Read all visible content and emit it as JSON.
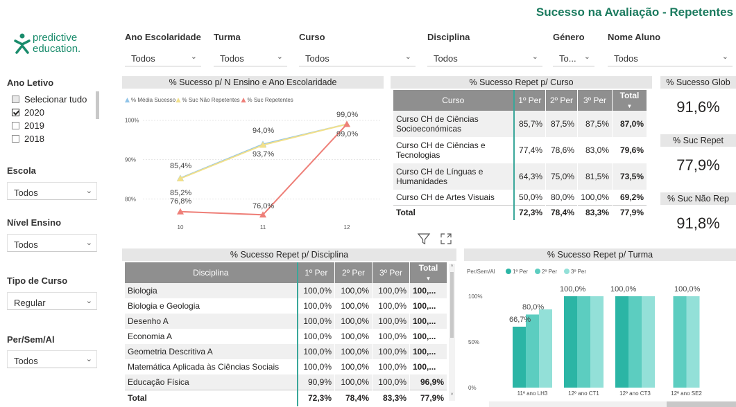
{
  "header": {
    "title": "Sucesso na Avaliação - Repetentes"
  },
  "logo": {
    "line1": "predictive",
    "line2": "education."
  },
  "filters": [
    {
      "label": "Ano Escolaridade",
      "value": "Todos"
    },
    {
      "label": "Turma",
      "value": "Todos"
    },
    {
      "label": "Curso",
      "value": "Todos"
    },
    {
      "label": "Disciplina",
      "value": "Todos"
    },
    {
      "label": "Género",
      "value": "To..."
    },
    {
      "label": "Nome Aluno",
      "value": "Todos"
    }
  ],
  "sidebar": {
    "ano_letivo": {
      "label": "Ano Letivo",
      "items": [
        {
          "label": "Selecionar tudo",
          "checked": false
        },
        {
          "label": "2020",
          "checked": true
        },
        {
          "label": "2019",
          "checked": false
        },
        {
          "label": "2018",
          "checked": false
        }
      ]
    },
    "escola": {
      "label": "Escola",
      "value": "Todos"
    },
    "nivel_ensino": {
      "label": "Nível Ensino",
      "value": "Todos"
    },
    "tipo_curso": {
      "label": "Tipo de Curso",
      "value": "Regular"
    },
    "per_sem": {
      "label": "Per/Sem/Al",
      "value": "Todos"
    }
  },
  "line_chart": {
    "title": "% Sucesso p/ N Ensino e Ano Escolaridade",
    "legend": [
      {
        "label": "% Média Sucesso",
        "color": "#8fc3e8"
      },
      {
        "label": "% Suc Não Repetentes",
        "color": "#f2e08a"
      },
      {
        "label": "% Suc Repetentes",
        "color": "#ee7f78"
      }
    ],
    "y_ticks": [
      "100%",
      "90%",
      "80%"
    ],
    "x_ticks": [
      "10",
      "11",
      "12"
    ]
  },
  "curso_table": {
    "title": "% Sucesso Repet p/ Curso",
    "headers": [
      "Curso",
      "1º Per",
      "2º Per",
      "3º Per",
      "Total"
    ],
    "rows": [
      [
        "Curso CH de Ciências Socioeconómicas",
        "85,7%",
        "87,5%",
        "87,5%",
        "87,0%"
      ],
      [
        "Curso CH de Ciências e Tecnologias",
        "77,4%",
        "78,6%",
        "83,0%",
        "79,6%"
      ],
      [
        "Curso CH de Línguas e Humanidades",
        "64,3%",
        "75,0%",
        "81,5%",
        "73,5%"
      ],
      [
        "Curso CH de Artes Visuais",
        "50,0%",
        "80,0%",
        "100,0%",
        "69,2%"
      ]
    ],
    "total": [
      "Total",
      "72,3%",
      "78,4%",
      "83,3%",
      "77,9%"
    ]
  },
  "cards": [
    {
      "title": "% Sucesso Glob",
      "value": "91,6%"
    },
    {
      "title": "% Suc Repet",
      "value": "77,9%"
    },
    {
      "title": "% Suc Não Rep",
      "value": "91,8%"
    }
  ],
  "disciplina_table": {
    "title": "% Sucesso Repet p/ Disciplina",
    "headers": [
      "Disciplina",
      "1º Per",
      "2º Per",
      "3º Per",
      "Total"
    ],
    "rows": [
      [
        "Biologia",
        "100,0%",
        "100,0%",
        "100,0%",
        "100,..."
      ],
      [
        "Biologia e Geologia",
        "100,0%",
        "100,0%",
        "100,0%",
        "100,..."
      ],
      [
        "Desenho A",
        "100,0%",
        "100,0%",
        "100,0%",
        "100,..."
      ],
      [
        "Economia A",
        "100,0%",
        "100,0%",
        "100,0%",
        "100,..."
      ],
      [
        "Geometria Descritiva A",
        "100,0%",
        "100,0%",
        "100,0%",
        "100,..."
      ],
      [
        "Matemática Aplicada às Ciências Sociais",
        "100,0%",
        "100,0%",
        "100,0%",
        "100,..."
      ],
      [
        "Educação Física",
        "90,9%",
        "100,0%",
        "100,0%",
        "96,9%"
      ]
    ],
    "total": [
      "Total",
      "72,3%",
      "78,4%",
      "83,3%",
      "77,9%"
    ]
  },
  "bar_chart": {
    "title": "% Sucesso Repet p/ Turma",
    "legend_title": "Per/Sem/Al",
    "legend": [
      {
        "label": "1º Per",
        "color": "#2bb5a5"
      },
      {
        "label": "2º Per",
        "color": "#5ccdc0"
      },
      {
        "label": "3º Per",
        "color": "#93e0d8"
      }
    ],
    "y_ticks": [
      "100%",
      "50%",
      "0%"
    ]
  },
  "chart_data": [
    {
      "type": "line",
      "title": "% Sucesso p/ N Ensino e Ano Escolaridade",
      "categories": [
        "10",
        "11",
        "12"
      ],
      "series": [
        {
          "name": "% Média Sucesso",
          "values": [
            85.3,
            93.9,
            99.0
          ]
        },
        {
          "name": "% Suc Não Repetentes",
          "values": [
            85.2,
            93.7,
            99.0
          ]
        },
        {
          "name": "% Suc Repetentes",
          "values": [
            76.8,
            76.0,
            99.0
          ]
        }
      ],
      "data_labels": [
        {
          "series": "% Média Sucesso",
          "values": [
            "85,4%",
            "94,0%",
            "99,0%"
          ]
        },
        {
          "series": "% Suc Não Repetentes",
          "values": [
            "85,2%",
            "93,7%",
            "99,0%"
          ]
        },
        {
          "series": "% Suc Repetentes",
          "values": [
            "76,8%",
            "76,0%",
            ""
          ]
        }
      ],
      "ylim": [
        75,
        101
      ]
    },
    {
      "type": "bar",
      "title": "% Sucesso Repet p/ Turma",
      "categories": [
        "11º ano LH3",
        "12º ano CT1",
        "12º ano CT3",
        "12º ano SE2"
      ],
      "series": [
        {
          "name": "1º Per",
          "values": [
            66.7,
            100.0,
            100.0,
            null
          ]
        },
        {
          "name": "2º Per",
          "values": [
            80.0,
            100.0,
            100.0,
            100.0
          ]
        },
        {
          "name": "3º Per",
          "values": [
            85.7,
            100.0,
            100.0,
            100.0
          ]
        }
      ],
      "data_labels": [
        "66,7%",
        "80,0%",
        "100,0%",
        "100,0%",
        "100,0%"
      ],
      "ylim": [
        0,
        115
      ]
    }
  ]
}
